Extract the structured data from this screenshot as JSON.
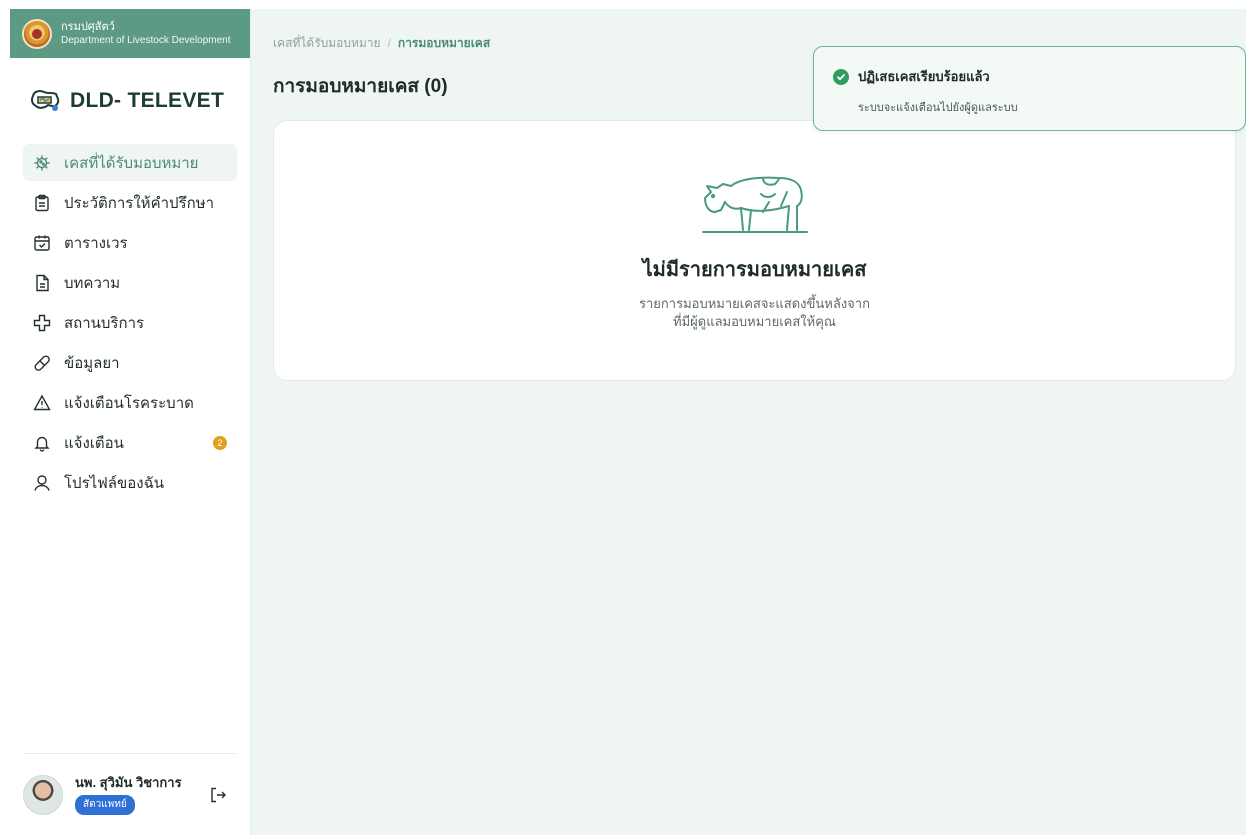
{
  "org": {
    "name_th": "กรมปศุสัตว์",
    "name_en": "Department of Livestock Development"
  },
  "brand": {
    "name": "DLD- TELEVET"
  },
  "sidebar": {
    "items": [
      {
        "label": "เคสที่ได้รับมอบหมาย",
        "icon": "virus-icon",
        "active": true
      },
      {
        "label": "ประวัติการให้คำปรึกษา",
        "icon": "clipboard-icon"
      },
      {
        "label": "ตารางเวร",
        "icon": "calendar-check-icon"
      },
      {
        "label": "บทความ",
        "icon": "document-icon"
      },
      {
        "label": "สถานบริการ",
        "icon": "medical-cross-icon"
      },
      {
        "label": "ข้อมูลยา",
        "icon": "pill-icon"
      },
      {
        "label": "แจ้งเตือนโรคระบาด",
        "icon": "warning-icon"
      },
      {
        "label": "แจ้งเตือน",
        "icon": "bell-icon",
        "badge": "2"
      },
      {
        "label": "โปรไฟล์ของฉัน",
        "icon": "user-icon"
      }
    ]
  },
  "user": {
    "name": "นพ. สุวิมัน วิชาการ",
    "role": "สัตวแพทย์"
  },
  "breadcrumb": {
    "parent": "เคสที่ได้รับมอบหมาย",
    "separator": "/",
    "current": "การมอบหมายเคส"
  },
  "page": {
    "title": "การมอบหมายเคส (0)"
  },
  "empty_state": {
    "title": "ไม่มีรายการมอบหมายเคส",
    "line1": "รายการมอบหมายเคสจะแสดงขึ้นหลังจาก",
    "line2": "ที่มีผู้ดูแลมอบหมายเคสให้คุณ"
  },
  "toast": {
    "title": "ปฏิเสธเคสเรียบร้อยแล้ว",
    "message": "ระบบจะแจ้งเตือนไปยังผู้ดูแลระบบ"
  },
  "colors": {
    "accent": "#4a8c74",
    "org_bar": "#5c9a84",
    "badge": "#e0a022",
    "role_badge": "#2f6fd6"
  }
}
